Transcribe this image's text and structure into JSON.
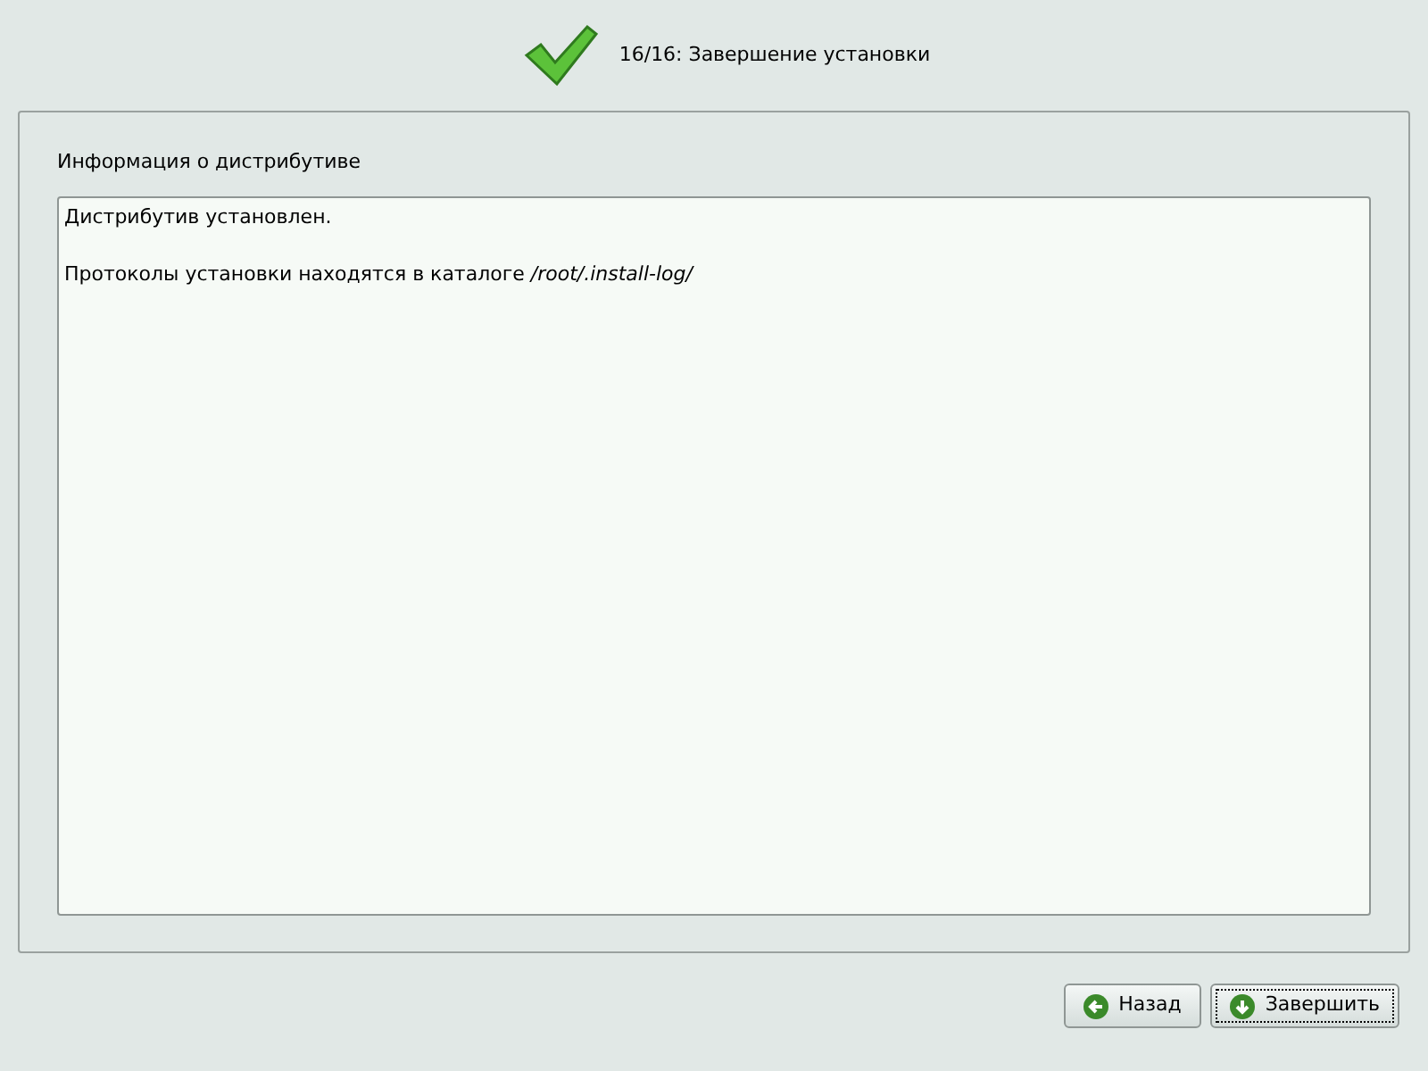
{
  "header": {
    "step": "16/16:",
    "title": "Завершение установки"
  },
  "section": {
    "label": "Информация о дистрибутиве",
    "lines": [
      "Дистрибутив установлен.",
      "Протоколы установки находятся в каталоге */root/.install-log/*"
    ]
  },
  "buttons": [
    {
      "label": "Назад",
      "kind": "back",
      "focused": false
    },
    {
      "label": "Завершить",
      "kind": "finish",
      "focused": true
    }
  ]
}
